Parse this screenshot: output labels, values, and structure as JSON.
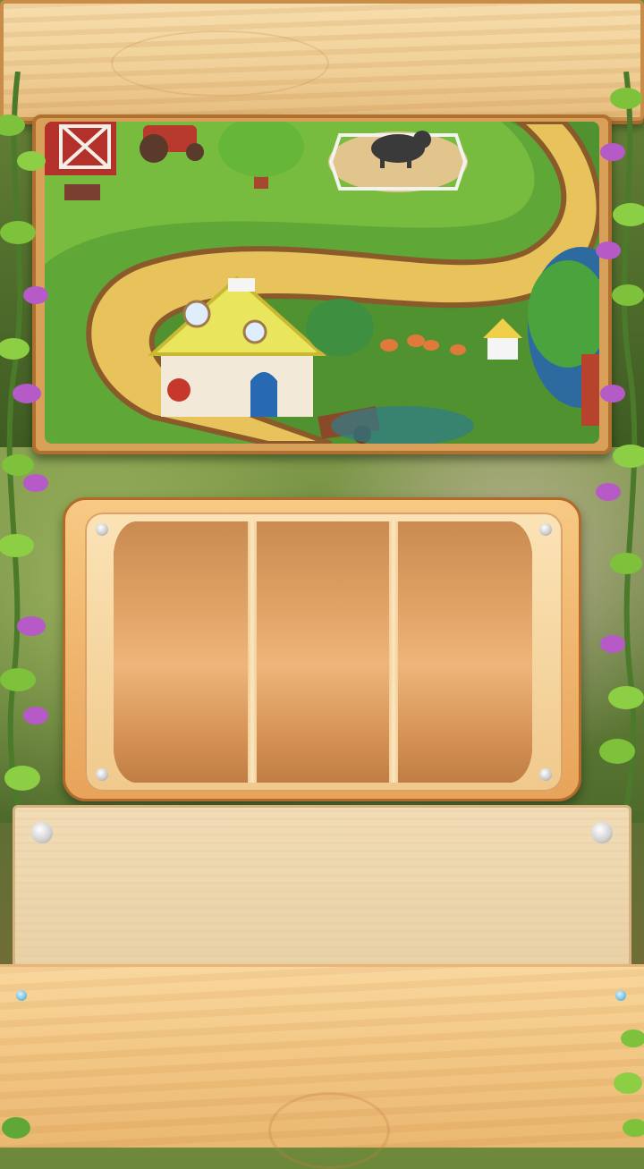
{
  "game": {
    "scene": "farm-map",
    "slot_machine": {
      "reels": 3
    }
  },
  "colors": {
    "wood_light": "#f6dcaa",
    "wood_frame": "#c98d4a",
    "reel_orange": "#e3a467",
    "grass": "#5fa838",
    "path": "#e8c25a",
    "flower": "#b65ac8",
    "leaf": "#7dc23a"
  },
  "icons": [
    "barn-icon",
    "tractor-icon",
    "bull-icon",
    "cottage-icon",
    "chicken-icon",
    "doghouse-icon",
    "cart-icon",
    "flower-vine-icon",
    "bolt-icon"
  ]
}
